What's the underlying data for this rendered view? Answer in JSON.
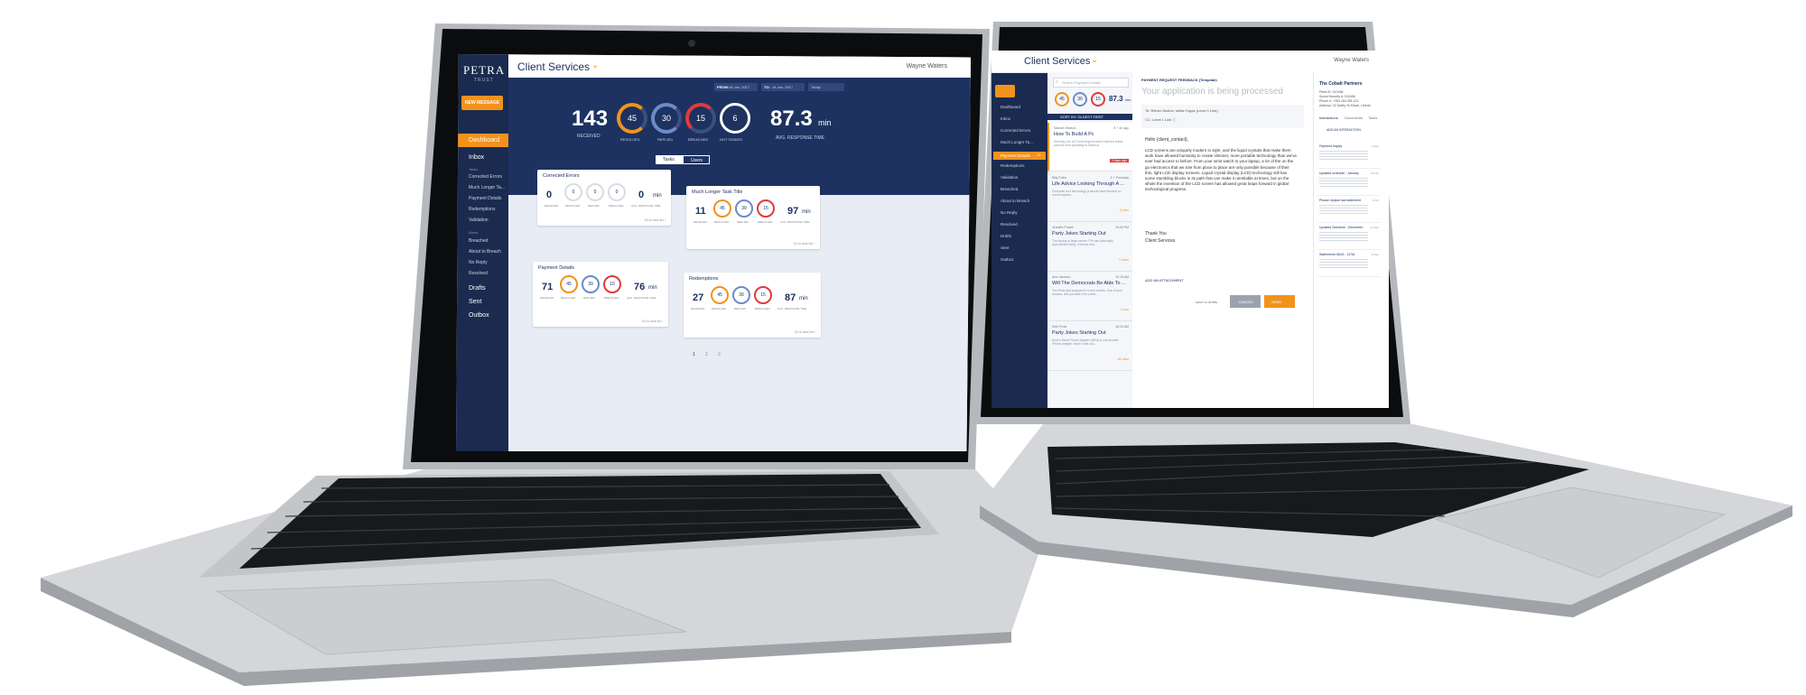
{
  "app": {
    "logo": "PETRA",
    "logo_sub": "TRUST",
    "title": "Client Services",
    "user": "Wayne Waters"
  },
  "left_laptop": {
    "new_message": "NEW MESSAGE",
    "sidebar": {
      "dashboard": "Dashboard",
      "inbox": "Inbox",
      "tasks_heading": "Tasks",
      "tasks": [
        "Corrected Errors",
        "Much Longer Ta...",
        "Payment Details",
        "Redemptions",
        "Validation"
      ],
      "alerts_heading": "Alerts",
      "alerts": [
        "Breached",
        "About to Breach",
        "No Reply",
        "Resolved"
      ],
      "drafts": "Drafts",
      "sent": "Sent",
      "outbox": "Outbox"
    },
    "filters": {
      "from_label": "FROM:",
      "from_value": "18 Jan, 2017",
      "to_label": "TO:",
      "to_value": "18 Jan, 2017",
      "range": "Today"
    },
    "summary": {
      "received_value": "143",
      "received_label": "RECEIVED",
      "resolved_value": "45",
      "resolved_label": "RESOLVED",
      "replied_value": "30",
      "replied_label": "REPLIED",
      "breached_value": "15",
      "breached_label": "BREACHED",
      "not_tasked_value": "6",
      "not_tasked_label": "NOT TASKED",
      "response_value": "87.3",
      "response_unit": "min",
      "response_label": "AVG. RESPONSE TIME"
    },
    "toggle": {
      "tasks": "Tasks",
      "users": "Users"
    },
    "cards": [
      {
        "title": "Corrected Errors",
        "received": "0",
        "resolved": "0",
        "replied": "0",
        "breached": "0",
        "time": "0",
        "unit": "min",
        "link": "Go to task list ›"
      },
      {
        "title": "Much Longer Task Title",
        "received": "11",
        "resolved": "45",
        "replied": "30",
        "breached": "15",
        "time": "97",
        "unit": "min",
        "link": "Go to task list ›"
      },
      {
        "title": "Payment Details",
        "received": "71",
        "resolved": "45",
        "replied": "30",
        "breached": "15",
        "time": "76",
        "unit": "min",
        "link": "Go to task list ›"
      },
      {
        "title": "Redemptions",
        "received": "27",
        "resolved": "45",
        "replied": "30",
        "breached": "15",
        "time": "87",
        "unit": "min",
        "link": "Go to task list ›"
      }
    ],
    "card_labels": {
      "received": "RECEIVED",
      "resolved": "RESOLVED",
      "replied": "REPLIED",
      "breached": "BREACHED",
      "avg": "AVG. RESPONSE TIME"
    },
    "pages": [
      "1",
      "2",
      "3"
    ]
  },
  "right_laptop": {
    "search_placeholder": "Search Payment Details",
    "mini_stats": {
      "resolved": "45",
      "replied": "30",
      "breached": "15",
      "time": "87.3",
      "unit": "min",
      "label": "AVG. RESPONSE TIME"
    },
    "sort_bar": "SORT BY: OLDEST FIRST",
    "list": [
      {
        "name": "Samuel Watson",
        "time": "8 + 4h ago",
        "title": "How To Build A Pc",
        "snippet": "Recently, the US Federal government banned online casinos from operating in America...",
        "flag": "3 days ago"
      },
      {
        "name": "Billy Fuller",
        "time": "5 + Thursday",
        "title": "Life Advice Looking Through A ...",
        "snippet": "Computer and technology products have become so commonplace...",
        "flag": "3 mins"
      },
      {
        "name": "Jennifer Powell",
        "time": "15:05 PM",
        "title": "Party Jokes Starting Out",
        "snippet": "The buying of large screen TVs has absolutely skyrocketed lately. It seems that...",
        "flag": "7 hours"
      },
      {
        "name": "Ann Harrison",
        "time": "10:15 AM",
        "title": "Will The Democrats Be Able To ...",
        "snippet": "The iPads just snapped in a new vehicle. One of your dreams, and you take it for a test...",
        "flag": "1 hour"
      },
      {
        "name": "Seth Frost",
        "time": "16:24 AM",
        "title": "Party Jokes Starting Out",
        "snippet": "Bose's Music Power Adapter (MPA) is one favorite iPhone adapter, since it lets you...",
        "flag": "85 mins"
      }
    ],
    "sidebar": [
      "Dashboard",
      "Inbox",
      "Corrected Errors",
      "Much Longer Ta...",
      "Payment Details",
      "Redemptions",
      "Validation",
      "Breached",
      "About to Breach",
      "No Reply",
      "Resolved",
      "Drafts",
      "Sent",
      "Outbox"
    ],
    "sidebar_badge": "12",
    "compose": {
      "tag": "PAYMENT REQUEST FEEDBACK (Template)",
      "subject": "Your application is being processed",
      "to": "To: Reiner Morton, stella Fogaz (Level 1 Link)",
      "cc": "CC: Level 1 Link ⓘ",
      "greeting": "Hello {client_contact},",
      "body": "LCD screens are uniquely modern in style, and the liquid crystals that make them work have allowed humanity to create slimmer, more portable technology than we've ever had access to before. From your wrist watch to your laptop, a lot of the on the go electronics that we tote from place to place are only possible because of their thin, light LCD display screens. Liquid crystal display (LCD) technology still has some stumbling blocks in its path that can make it unreliable at times, but on the whole the invention of the LCD screen has allowed great leaps forward in global technological progress.",
      "signoff": "Thank You",
      "signature": "Client Services",
      "attach": "ADD AN ATTACHMENT",
      "save": "save to drafts",
      "cancel": "CANCEL",
      "send": "SEND"
    },
    "contact": {
      "name": "The Cobalt Partners",
      "line1": "Petra ID: 010456",
      "line2": "Social Security #: 010456",
      "line3": "Phone #: +353 184 255 122",
      "line4": "Address: 32 Dalley St Kisoni, Liberia",
      "tabs": [
        "Interactions",
        "Documents",
        "Tasks"
      ],
      "add": "ADD AN INTERACTION",
      "items": [
        {
          "title": "Payment Inquiry",
          "time": "2 Nov"
        },
        {
          "title": "Updated schedule - January",
          "time": "29 Oct"
        },
        {
          "title": "Please replace last statement",
          "time": "6 Oct"
        },
        {
          "title": "Updated Schedule - December",
          "time": "21 Dec"
        },
        {
          "title": "Statements 08/16 - 12/16",
          "time": "8 Dec"
        }
      ]
    }
  }
}
